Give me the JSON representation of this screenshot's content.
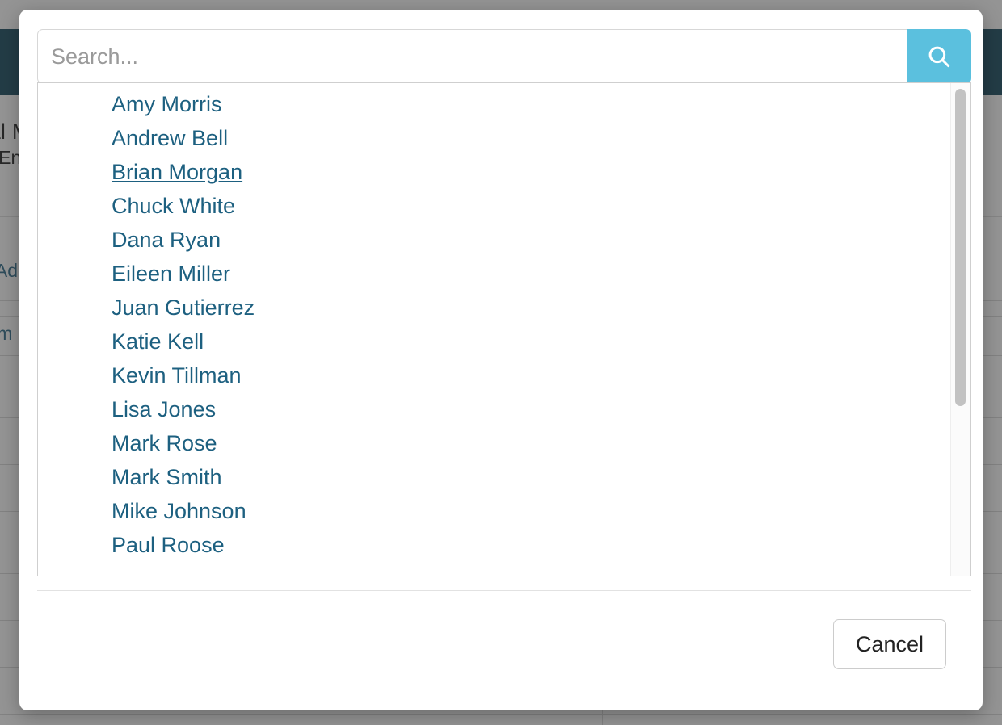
{
  "background": {
    "heading_fragment": "tal Management",
    "subheading_fragment": "vil Engineering",
    "link_fragment_1": "o Add Contact",
    "link_fragment_2": "Tim Baker"
  },
  "modal": {
    "search": {
      "placeholder": "Search...",
      "value": "",
      "button_icon": "search-icon",
      "button_color": "#5bc0de"
    },
    "results": {
      "hovered_index": 2,
      "items": [
        "Amy Morris",
        "Andrew Bell",
        "Brian Morgan",
        "Chuck White",
        "Dana Ryan",
        "Eileen Miller",
        "Juan Gutierrez",
        "Katie Kell",
        "Kevin Tillman",
        "Lisa Jones",
        "Mark Rose",
        "Mark Smith",
        "Mike Johnson",
        "Paul Roose"
      ],
      "link_color": "#1d6080"
    },
    "footer": {
      "cancel_label": "Cancel"
    }
  }
}
